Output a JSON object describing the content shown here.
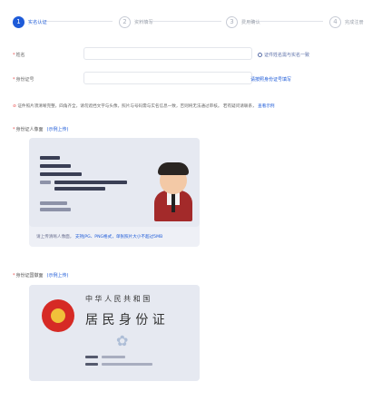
{
  "stepper": {
    "steps": [
      {
        "num": "1",
        "label": "实名认证"
      },
      {
        "num": "2",
        "label": "资料填写"
      },
      {
        "num": "3",
        "label": "费用确认"
      },
      {
        "num": "4",
        "label": "完成注册"
      }
    ]
  },
  "form": {
    "name": {
      "required": "*",
      "label": "姓名",
      "placeholder": ""
    },
    "id_number": {
      "required": "*",
      "label": "身份证号",
      "placeholder": ""
    },
    "name_hint": "证件姓名需与实名一致",
    "id_hint": "请按照身份证号填写"
  },
  "notice": {
    "warn_icon": "warning-icon",
    "text_a": "证件照片须清晰完整，四角齐全，请勿遮挡文字与头像，照片与号码需与实名信息一致，否则将无法通过审核。",
    "text_b": "若有疑问请联系，",
    "text_c": "查看示例"
  },
  "front": {
    "title_required": "*",
    "title": "身份证人像面",
    "title_sub": "(示例上传)",
    "caption_a": "请上传清晰人像面，",
    "caption_b": "支持JPG、PNG格式，单张照片大小不超过5MB"
  },
  "back": {
    "title_required": "*",
    "title": "身份证国徽面",
    "title_sub": "(示例上传)",
    "line1": "中 华 人 民 共 和 国",
    "line2": "居 民 身 份 证"
  }
}
